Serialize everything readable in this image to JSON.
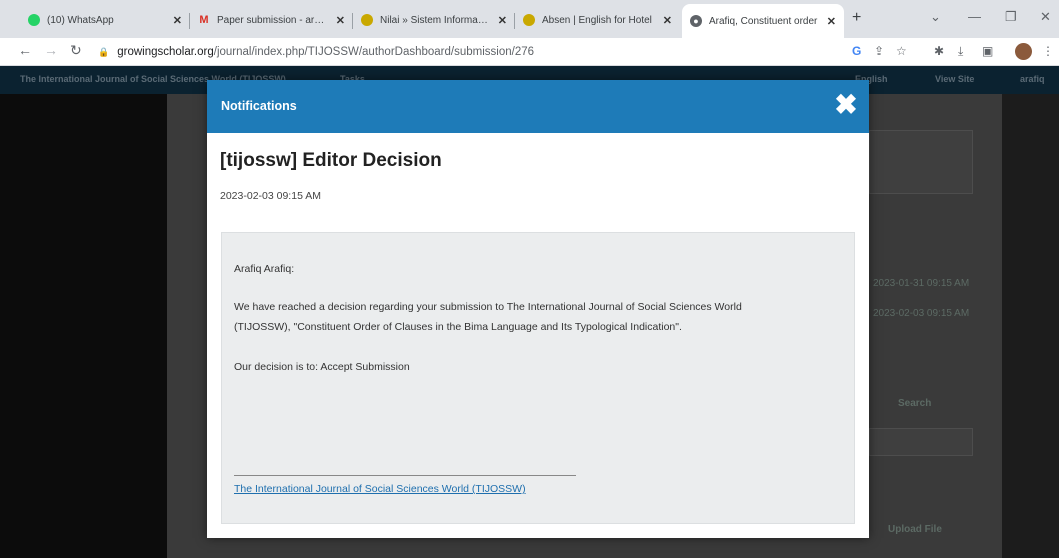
{
  "browser": {
    "tabs": [
      {
        "title": "(10) WhatsApp",
        "favicon": "whatsapp-icon",
        "color": "#25d366"
      },
      {
        "title": "Paper submission - arafiq@",
        "favicon": "gmail-icon",
        "color": "#d93025"
      },
      {
        "title": "Nilai » Sistem Informasi Ak",
        "favicon": "site-icon",
        "color": "#c9a800"
      },
      {
        "title": "Absen | English for Hotel",
        "favicon": "site-icon",
        "color": "#c9a800"
      },
      {
        "title": "Arafiq, Constituent order",
        "favicon": "globe-icon",
        "color": "#5f6368"
      }
    ],
    "url_host": "growingscholar.org",
    "url_path": "/journal/index.php/TIJOSSW/authorDashboard/submission/276"
  },
  "site": {
    "title": "The International Journal of Social Sciences World (TIJOSSW)",
    "tasks": "Tasks",
    "lang": "English",
    "view_site": "View Site",
    "user": "arafiq",
    "dates": [
      "2023-01-31 09:15 AM",
      "2023-02-03 09:15 AM"
    ],
    "search": "Search",
    "upload": "Upload File"
  },
  "modal": {
    "title": "Notifications",
    "subject": "[tijossw] Editor Decision",
    "date": "2023-02-03 09:15 AM",
    "greeting": "Arafiq Arafiq:",
    "body_line1": "We have reached a decision regarding your submission to The International Journal of Social Sciences World",
    "body_line2": "(TIJOSSW), \"Constituent Order of Clauses in the Bima Language and Its Typological Indication\".",
    "decision": "Our decision is to: Accept Submission",
    "footer_link": "The International Journal of Social Sciences World (TIJOSSW)"
  },
  "colors": {
    "accent": "#1e7bb8",
    "link": "#1e6fae",
    "message_bg": "#ebedee"
  }
}
